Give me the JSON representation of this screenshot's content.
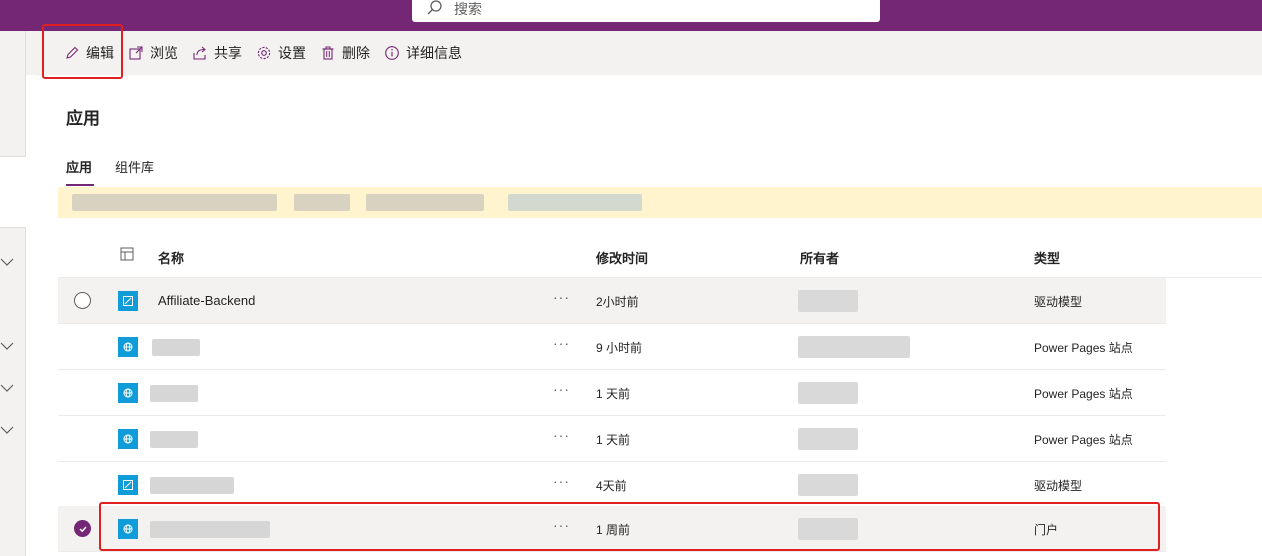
{
  "search": {
    "placeholder": "搜索",
    "icon": "search-icon"
  },
  "toolbar": {
    "edit": "编辑",
    "browse": "浏览",
    "share": "共享",
    "settings": "设置",
    "delete": "删除",
    "details": "详细信息"
  },
  "page": {
    "title": "应用"
  },
  "tabs": [
    {
      "label": "应用",
      "active": true
    },
    {
      "label": "组件库",
      "active": false
    }
  ],
  "table": {
    "columns": {
      "name": "名称",
      "modified": "修改时间",
      "owner": "所有者",
      "type": "类型"
    },
    "rows": [
      {
        "name": "Affiliate-Backend",
        "modified": "2小时前",
        "type": "驱动模型",
        "icon": "model-app-icon",
        "selected": false
      },
      {
        "name": "",
        "modified": "9 小时前",
        "type": "Power Pages 站点",
        "icon": "globe-icon",
        "selected": false
      },
      {
        "name": "",
        "modified": "1 天前",
        "type": "Power Pages 站点",
        "icon": "globe-icon",
        "selected": false
      },
      {
        "name": "",
        "modified": "1 天前",
        "type": "Power Pages 站点",
        "icon": "globe-icon",
        "selected": false
      },
      {
        "name": "",
        "modified": "4天前",
        "type": "驱动模型",
        "icon": "model-app-icon",
        "selected": false
      },
      {
        "name": "",
        "modified": "1 周前",
        "type": "门户",
        "icon": "globe-icon",
        "selected": true
      }
    ]
  },
  "colors": {
    "brand": "#742774",
    "highlight": "#e02020",
    "appIcon": "#0f9cd8",
    "banner": "#fff4ce"
  }
}
